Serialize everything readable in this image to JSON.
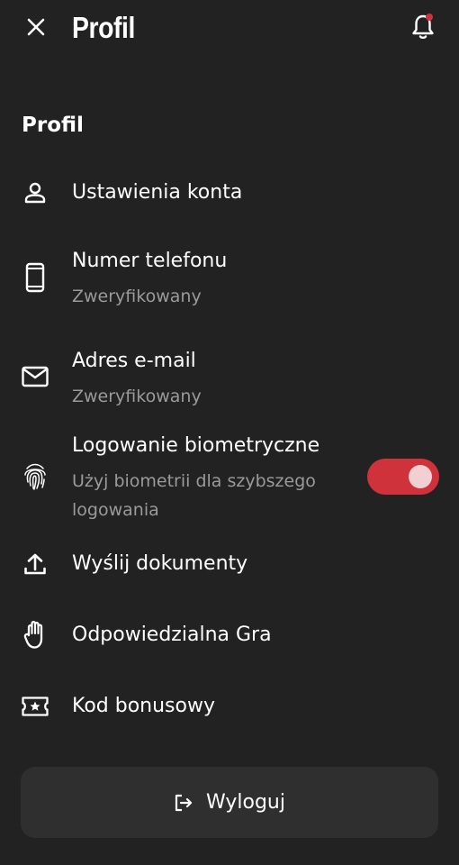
{
  "colors": {
    "background": "#222222",
    "text_primary": "#ffffff",
    "text_secondary": "#9a9a9a",
    "accent_red": "#d0323b",
    "button_surface": "#2f2f2f"
  },
  "header": {
    "close_icon": "close-icon",
    "title": "Profil",
    "bell_icon": "bell-icon",
    "has_notification_dot": true
  },
  "section": {
    "title": "Profil"
  },
  "menu": {
    "account_settings": {
      "icon": "person-icon",
      "label": "Ustawienia konta"
    },
    "phone": {
      "icon": "smartphone-icon",
      "label": "Numer telefonu",
      "status": "Zweryfikowany"
    },
    "email": {
      "icon": "mail-icon",
      "label": "Adres e-mail",
      "status": "Zweryfikowany"
    },
    "biometric": {
      "icon": "fingerprint-icon",
      "label": "Logowanie biometryczne",
      "description_line1": "Użyj biometrii dla szybszego",
      "description_line2": "logowania",
      "enabled": true
    },
    "documents": {
      "icon": "upload-icon",
      "label": "Wyślij dokumenty"
    },
    "responsible_gaming": {
      "icon": "hand-icon",
      "label": "Odpowiedzialna Gra"
    },
    "bonus_code": {
      "icon": "ticket-icon",
      "label": "Kod bonusowy"
    }
  },
  "logout": {
    "icon": "logout-icon",
    "label": "Wyloguj"
  }
}
